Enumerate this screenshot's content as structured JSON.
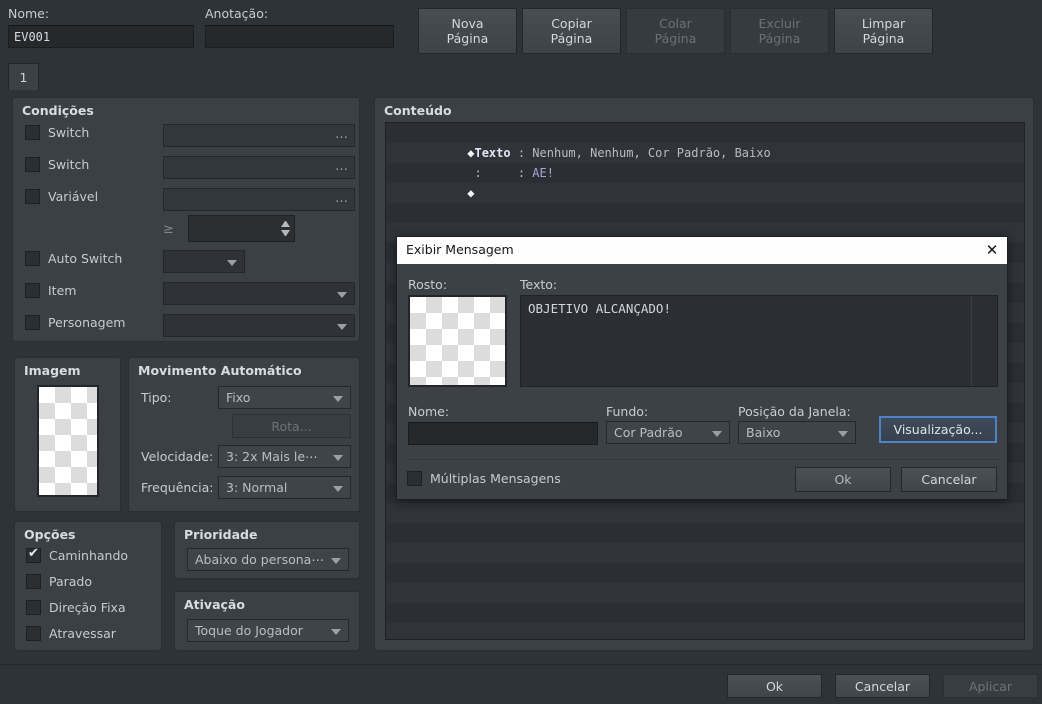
{
  "window": {
    "nome_label": "Nome:",
    "nome_value": "EV001",
    "anotacao_label": "Anotação:",
    "anotacao_value": ""
  },
  "page_buttons": [
    {
      "line1": "Nova",
      "line2": "Página",
      "disabled": false
    },
    {
      "line1": "Copiar",
      "line2": "Página",
      "disabled": false
    },
    {
      "line1": "Colar",
      "line2": "Página",
      "disabled": true
    },
    {
      "line1": "Excluir",
      "line2": "Página",
      "disabled": true
    },
    {
      "line1": "Limpar",
      "line2": "Página",
      "disabled": false
    }
  ],
  "tabs": [
    {
      "label": "1",
      "active": true
    }
  ],
  "conditions": {
    "title": "Condições",
    "rows": [
      {
        "label": "Switch",
        "checked": false,
        "value": ""
      },
      {
        "label": "Switch",
        "checked": false,
        "value": ""
      },
      {
        "label": "Variável",
        "checked": false,
        "value": ""
      },
      {
        "label": "Auto Switch",
        "checked": false,
        "value": ""
      },
      {
        "label": "Item",
        "checked": false,
        "value": ""
      },
      {
        "label": "Personagem",
        "checked": false,
        "value": ""
      }
    ],
    "operator": "≥",
    "operand_value": ""
  },
  "imagem": {
    "title": "Imagem"
  },
  "movimento": {
    "title": "Movimento Automático",
    "tipo_label": "Tipo:",
    "tipo_value": "Fixo",
    "rota_label": "Rota...",
    "velocidade_label": "Velocidade:",
    "velocidade_value": "3: 2x Mais le⋯",
    "frequencia_label": "Frequência:",
    "frequencia_value": "3: Normal"
  },
  "opcoes": {
    "title": "Opções",
    "items": [
      {
        "label": "Caminhando",
        "checked": true
      },
      {
        "label": "Parado",
        "checked": false
      },
      {
        "label": "Direção Fixa",
        "checked": false
      },
      {
        "label": "Atravessar",
        "checked": false
      }
    ]
  },
  "prioridade": {
    "title": "Prioridade",
    "value": "Abaixo do persona⋯"
  },
  "ativacao": {
    "title": "Ativação",
    "value": "Toque do Jogador"
  },
  "conteudo": {
    "title": "Conteúdo",
    "rows": [
      {
        "diamond": true,
        "keyword": "Texto",
        "sep": " : ",
        "value": "Nenhum, Nenhum, Cor Padrão, Baixo",
        "style": "val"
      },
      {
        "diamond": false,
        "keyword": ":",
        "sep": "     : ",
        "value": "AE!",
        "style": "txt"
      },
      {
        "diamond": true,
        "keyword": "",
        "sep": "",
        "value": "",
        "style": "val"
      }
    ]
  },
  "dialog": {
    "title": "Exibir Mensagem",
    "close_icon": "✕",
    "rosto_label": "Rosto:",
    "texto_label": "Texto:",
    "texto_value": "OBJETIVO ALCANÇADO!",
    "nome_label": "Nome:",
    "nome_value": "",
    "fundo_label": "Fundo:",
    "fundo_value": "Cor Padrão",
    "posicao_label": "Posição da Janela:",
    "posicao_value": "Baixo",
    "visualizacao_label": "Visualização...",
    "multiplas_label": "Múltiplas Mensagens",
    "multiplas_checked": false,
    "ok_label": "Ok",
    "cancelar_label": "Cancelar"
  },
  "footer": {
    "ok_label": "Ok",
    "cancelar_label": "Cancelar",
    "aplicar_label": "Aplicar",
    "aplicar_disabled": true
  },
  "colors": {
    "background": "#2e3337",
    "panel": "#3a4044",
    "field": "#2b2f33",
    "accent_focus": "#4f82c6",
    "text": "#c7ccd1",
    "text_disabled": "#6d7378",
    "titlebar": "#fefefe"
  }
}
